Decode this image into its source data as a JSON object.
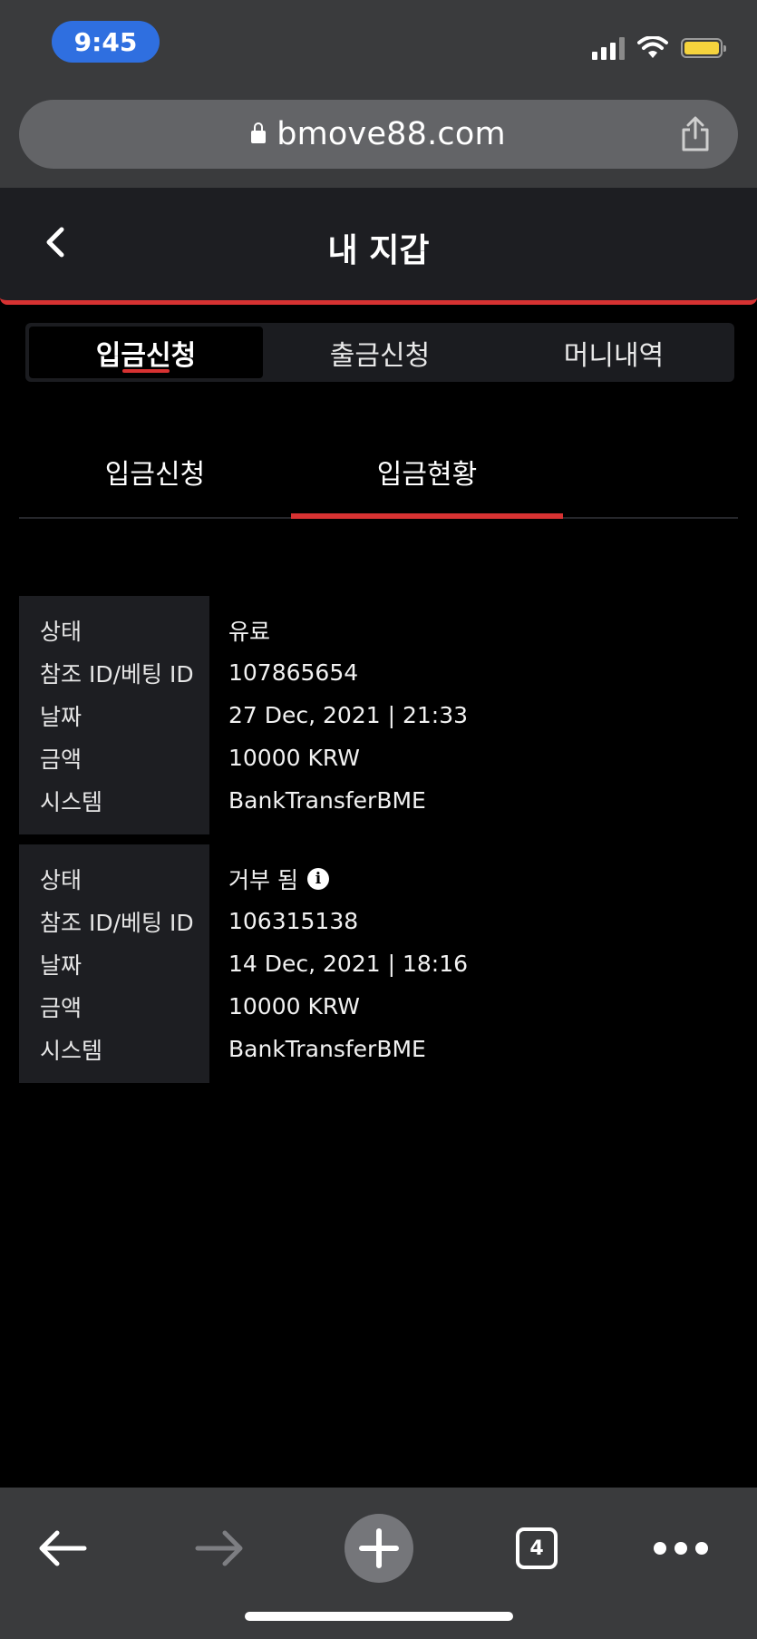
{
  "status_bar": {
    "time": "9:45"
  },
  "browser": {
    "url": "bmove88.com",
    "tab_count": "4"
  },
  "header": {
    "title": "내 지갑"
  },
  "main_tabs": [
    {
      "label": "입금신청",
      "active": true
    },
    {
      "label": "출금신청",
      "active": false
    },
    {
      "label": "머니내역",
      "active": false
    }
  ],
  "sub_tabs": [
    {
      "label": "입금신청",
      "active": false
    },
    {
      "label": "입금현황",
      "active": true
    }
  ],
  "records": [
    {
      "rows": [
        {
          "label": "상태",
          "value": "유료"
        },
        {
          "label": "참조 ID/베팅 ID",
          "value": "107865654"
        },
        {
          "label": "날짜",
          "value": "27 Dec, 2021 | 21:33"
        },
        {
          "label": "금액",
          "value": "10000 KRW"
        },
        {
          "label": "시스템",
          "value": "BankTransferBME"
        }
      ]
    },
    {
      "rows": [
        {
          "label": "상태",
          "value": "거부 됨",
          "info_icon": "info-icon"
        },
        {
          "label": "참조 ID/베팅 ID",
          "value": "106315138"
        },
        {
          "label": "날짜",
          "value": "14 Dec, 2021 | 18:16"
        },
        {
          "label": "금액",
          "value": "10000 KRW"
        },
        {
          "label": "시스템",
          "value": "BankTransferBME"
        }
      ]
    }
  ],
  "colors": {
    "accent": "#d73232",
    "time_pill": "#2f6fe0",
    "battery": "#f5d33d"
  }
}
